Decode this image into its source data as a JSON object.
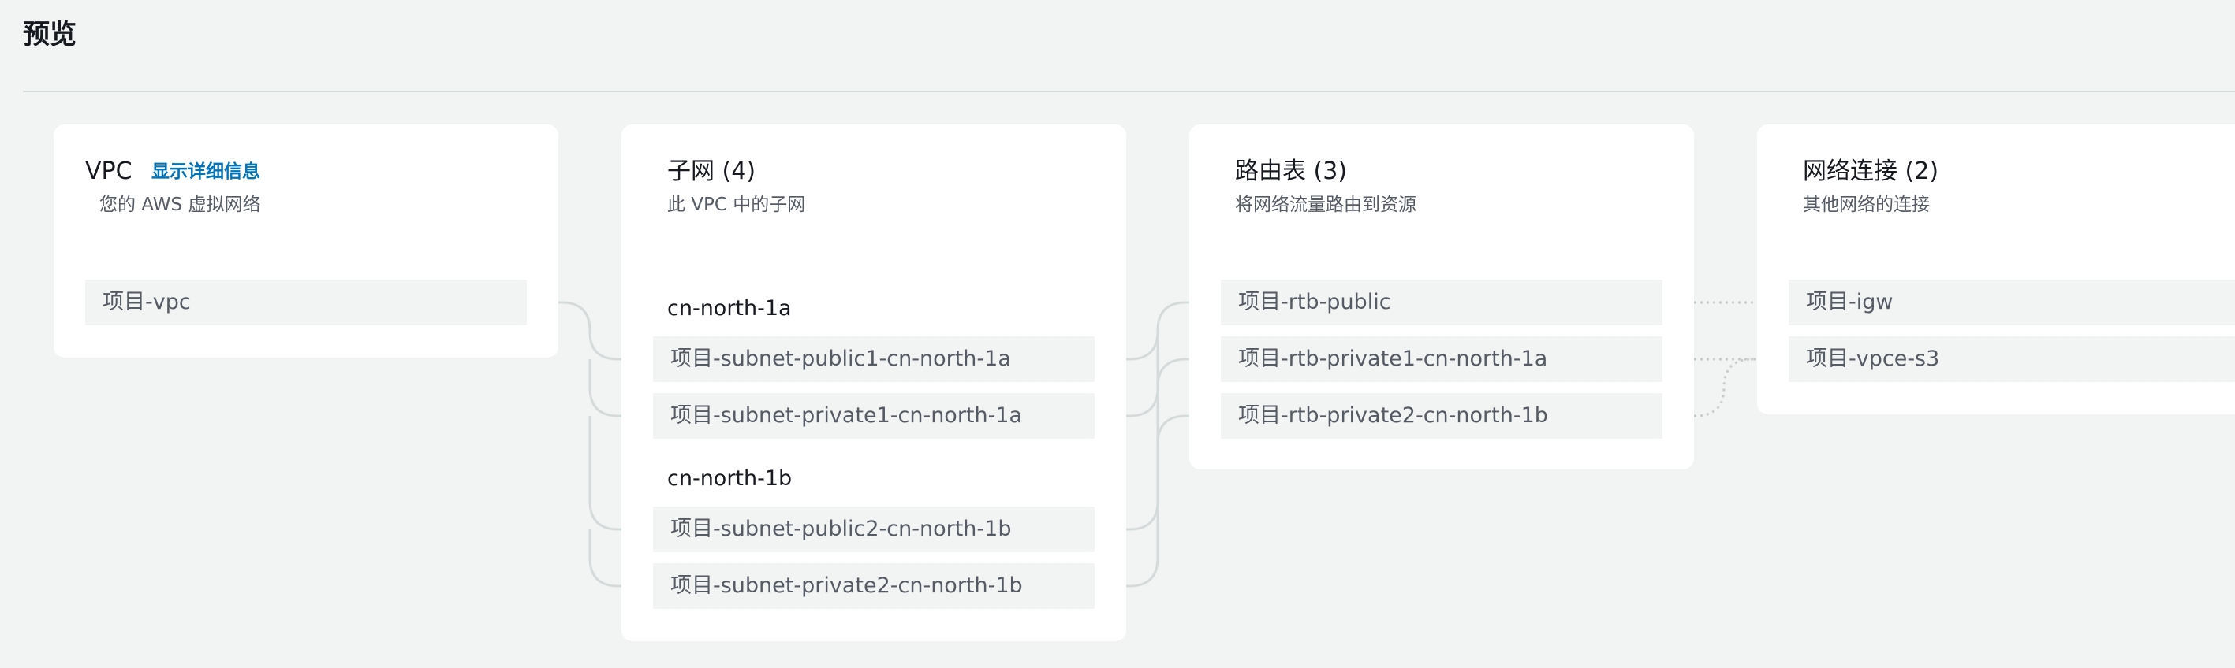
{
  "page": {
    "title": "预览"
  },
  "vpc_card": {
    "title": "VPC",
    "detail_link": "显示详细信息",
    "description": "您的 AWS 虚拟网络",
    "items": [
      "项目-vpc"
    ]
  },
  "subnets_card": {
    "title": "子网 (4)",
    "description": "此 VPC 中的子网",
    "groups": [
      {
        "az": "cn-north-1a",
        "items": [
          "项目-subnet-public1-cn-north-1a",
          "项目-subnet-private1-cn-north-1a"
        ]
      },
      {
        "az": "cn-north-1b",
        "items": [
          "项目-subnet-public2-cn-north-1b",
          "项目-subnet-private2-cn-north-1b"
        ]
      }
    ]
  },
  "route_tables_card": {
    "title": "路由表 (3)",
    "description": "将网络流量路由到资源",
    "items": [
      "项目-rtb-public",
      "项目-rtb-private1-cn-north-1a",
      "项目-rtb-private2-cn-north-1b"
    ]
  },
  "network_connections_card": {
    "title": "网络连接 (2)",
    "description": "其他网络的连接",
    "items": [
      "项目-igw",
      "项目-vpce-s3"
    ]
  },
  "colors": {
    "background": "#f2f3f3",
    "card": "#ffffff",
    "link": "#0073bb",
    "connector": "#d5dbdb",
    "item_background": "#f2f3f3"
  }
}
